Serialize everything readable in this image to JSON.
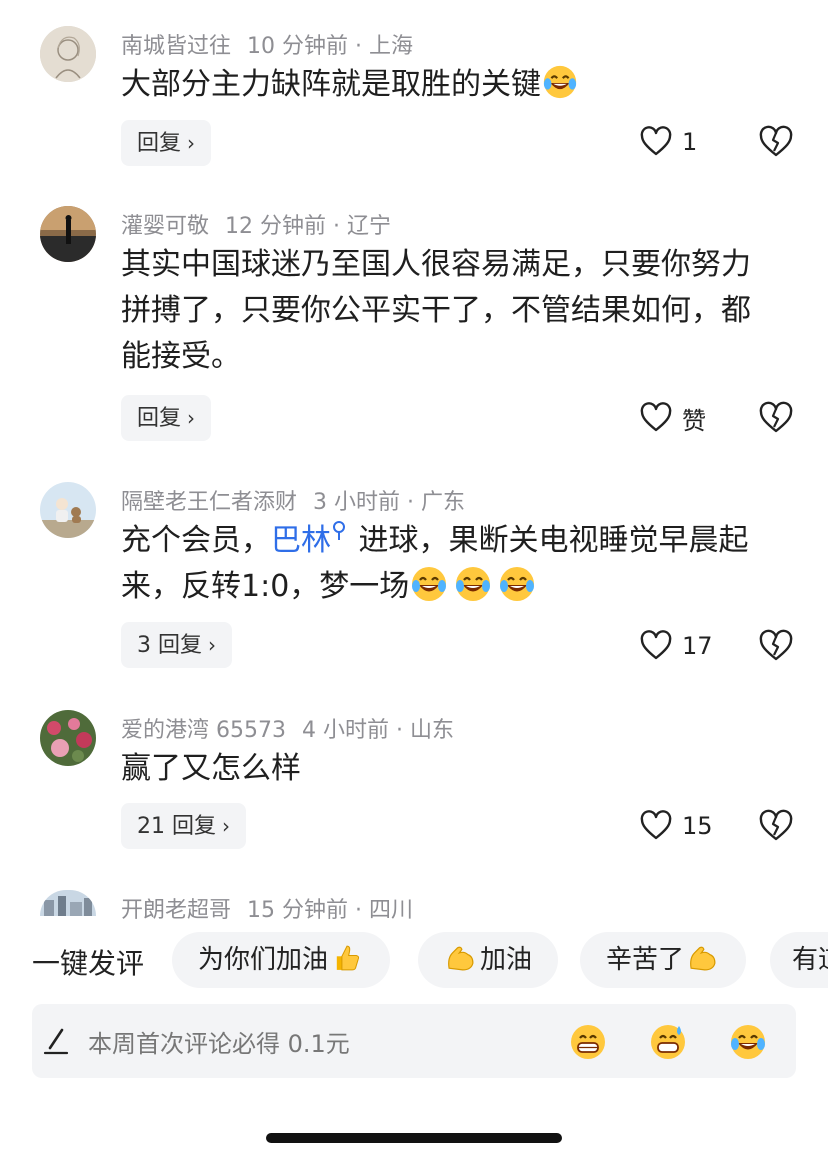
{
  "comments": [
    {
      "user": "南城皆过往",
      "time": "10 分钟前",
      "location": "上海",
      "text": "大部分主力缺阵就是取胜的关键",
      "reply_label": "回复",
      "likes": "1"
    },
    {
      "user": "灌婴可敬",
      "time": "12 分钟前",
      "location": "辽宁",
      "text": "其实中国球迷乃至国人很容易满足，只要你努力拼搏了，只要你公平实干了，不管结果如何，都能接受。",
      "reply_label": "回复",
      "likes": "赞"
    },
    {
      "user": "隔壁老王仁者添财",
      "time": "3 小时前",
      "location": "广东",
      "text_before": "充个会员，",
      "text_link": "巴林",
      "text_after": " 进球，果断关电视睡觉早晨起来，反转1:0，梦一场",
      "reply_label": "3 回复",
      "likes": "17"
    },
    {
      "user": "爱的港湾 65573",
      "time": "4 小时前",
      "location": "山东",
      "text": "赢了又怎么样",
      "reply_label": "21 回复",
      "likes": "15"
    },
    {
      "user": "开朗老超哥",
      "time": "15 分钟前",
      "location": "四川"
    }
  ],
  "meta_separator": "·",
  "quick_comment": {
    "label": "一键发评",
    "chips": [
      "为你们加油",
      "加油",
      "辛苦了",
      "有道"
    ]
  },
  "input": {
    "placeholder": "本周首次评论必得 0.1元"
  },
  "colors": {
    "link": "#2f6ee8",
    "meta": "#8e8e93",
    "chip_bg": "#f3f4f6"
  }
}
